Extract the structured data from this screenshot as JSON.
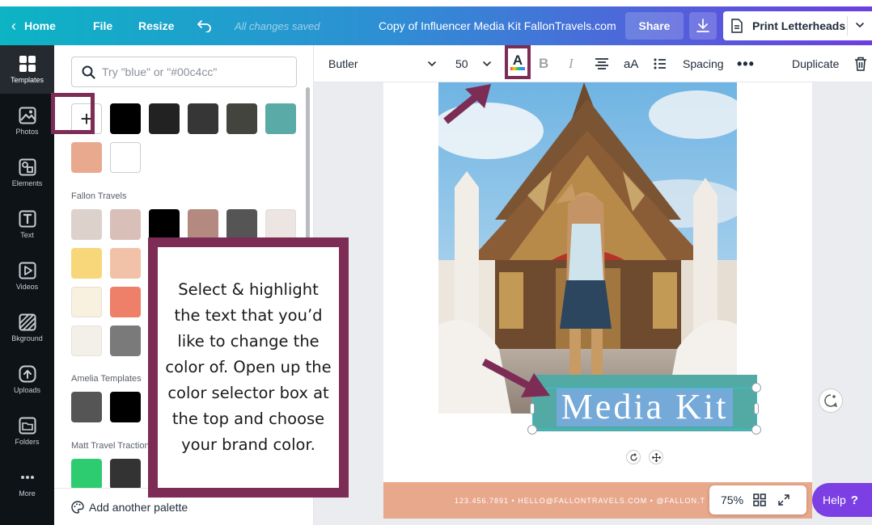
{
  "header": {
    "home_label": "Home",
    "file_label": "File",
    "resize_label": "Resize",
    "saved_status": "All changes saved",
    "doc_title": "Copy of Influencer Media Kit FallonTravels.com",
    "share_label": "Share",
    "print_label": "Print Letterheads"
  },
  "rail": {
    "items": [
      {
        "label": "Templates",
        "icon": "templates-icon"
      },
      {
        "label": "Photos",
        "icon": "photos-icon"
      },
      {
        "label": "Elements",
        "icon": "elements-icon"
      },
      {
        "label": "Text",
        "icon": "text-icon"
      },
      {
        "label": "Videos",
        "icon": "videos-icon"
      },
      {
        "label": "Bkground",
        "icon": "background-icon"
      },
      {
        "label": "Uploads",
        "icon": "uploads-icon"
      },
      {
        "label": "Folders",
        "icon": "folders-icon"
      },
      {
        "label": "More",
        "icon": "more-icon"
      }
    ]
  },
  "panel": {
    "search_placeholder": "Try \"blue\" or \"#00c4cc\"",
    "add_label": "+",
    "document_colors": [
      "#000000",
      "#222222",
      "#363636",
      "#44443f",
      "#5aaba7",
      "#e9a98e",
      "#ffffff"
    ],
    "groups": [
      {
        "title": "Fallon Travels",
        "colors": [
          "#ddd1cc",
          "#d8c0b8",
          "#000000",
          "#b48a80",
          "#555555",
          "#ede5e2",
          "#f8d77a",
          "#f2c2a8",
          "#f9f1e0",
          "#ee7f68",
          "#f3f0ea",
          "#7a7a7a"
        ]
      },
      {
        "title": "Amelia Templates",
        "colors": [
          "#555555",
          "#000000"
        ]
      },
      {
        "title": "Matt Travel Traction",
        "colors": [
          "#2ecc71",
          "#333333"
        ]
      }
    ],
    "footer_label": "Add another palette"
  },
  "toolbar": {
    "font": "Butler",
    "size": "50",
    "text_color_letter": "A",
    "bold": "B",
    "italic": "I",
    "case": "aA",
    "spacing": "Spacing",
    "more": "•••",
    "duplicate": "Duplicate"
  },
  "canvas": {
    "headline": "Media Kit",
    "footer_text": "123.456.7891 • HELLO@FALLONTRAVELS.COM • @FALLON.T"
  },
  "bottom": {
    "zoom": "75%",
    "help": "Help",
    "help_q": "?"
  },
  "callout": {
    "text": "Select & highlight the text that you’d like to change the color of. Open up the color selector box at the top and choose your brand color."
  },
  "colors": {
    "accent": "#7c2c55",
    "help_purple": "#7b3fe4",
    "teal_box": "#53a9a4",
    "highlight_blue": "#74a9d8",
    "footer_peach": "#e8a88c"
  }
}
